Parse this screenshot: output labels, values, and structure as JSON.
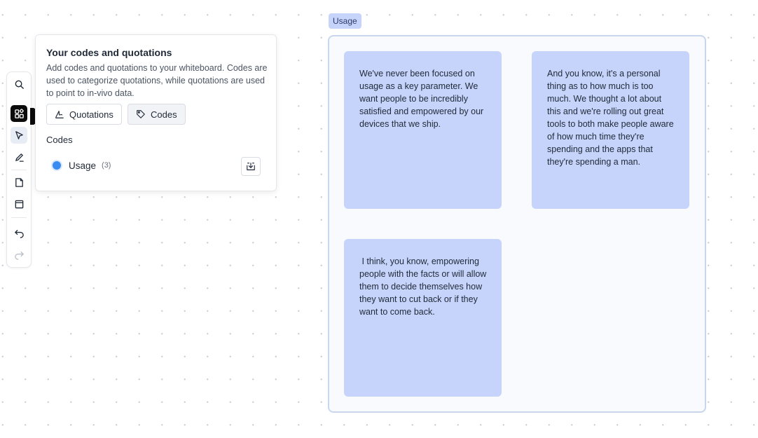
{
  "toolbar": {
    "tools": [
      {
        "id": "search",
        "icon": "search-icon"
      },
      {
        "id": "codes",
        "icon": "codes-grid-icon",
        "active": true
      },
      {
        "id": "select",
        "icon": "cursor-arrow-icon",
        "selected": true
      },
      {
        "id": "pen",
        "icon": "pen-icon"
      },
      {
        "id": "note",
        "icon": "sticky-note-icon"
      },
      {
        "id": "frame",
        "icon": "frame-icon"
      },
      {
        "id": "undo",
        "icon": "undo-icon"
      },
      {
        "id": "redo",
        "icon": "redo-icon",
        "disabled": true
      }
    ]
  },
  "panel": {
    "title": "Your codes and quotations",
    "description": "Add codes and quotations to your whiteboard. Codes are used to categorize quotations, while quotations are used to point to in-vivo data.",
    "quotations_label": "Quotations",
    "codes_button_label": "Codes",
    "codes_heading": "Codes",
    "codes": [
      {
        "name": "Usage",
        "count": "(3)",
        "color": "#3b8cf0"
      }
    ]
  },
  "board": {
    "group": {
      "label": "Usage",
      "color": "#c6d4fb",
      "notes": [
        {
          "text": "We've never been focused on usage as a key parameter. We want people to be incredibly satisfied and empowered by our devices that we ship."
        },
        {
          "text": "And you know, it's a personal thing as to how much is too much. We thought a lot about this and we're rolling out great tools to both make people aware of how much time they're spending and the apps that they're spending a man."
        },
        {
          "text": " I think, you know, empowering people with the facts or will allow them to decide themselves how they want to cut back or if they want to come back."
        }
      ]
    }
  }
}
